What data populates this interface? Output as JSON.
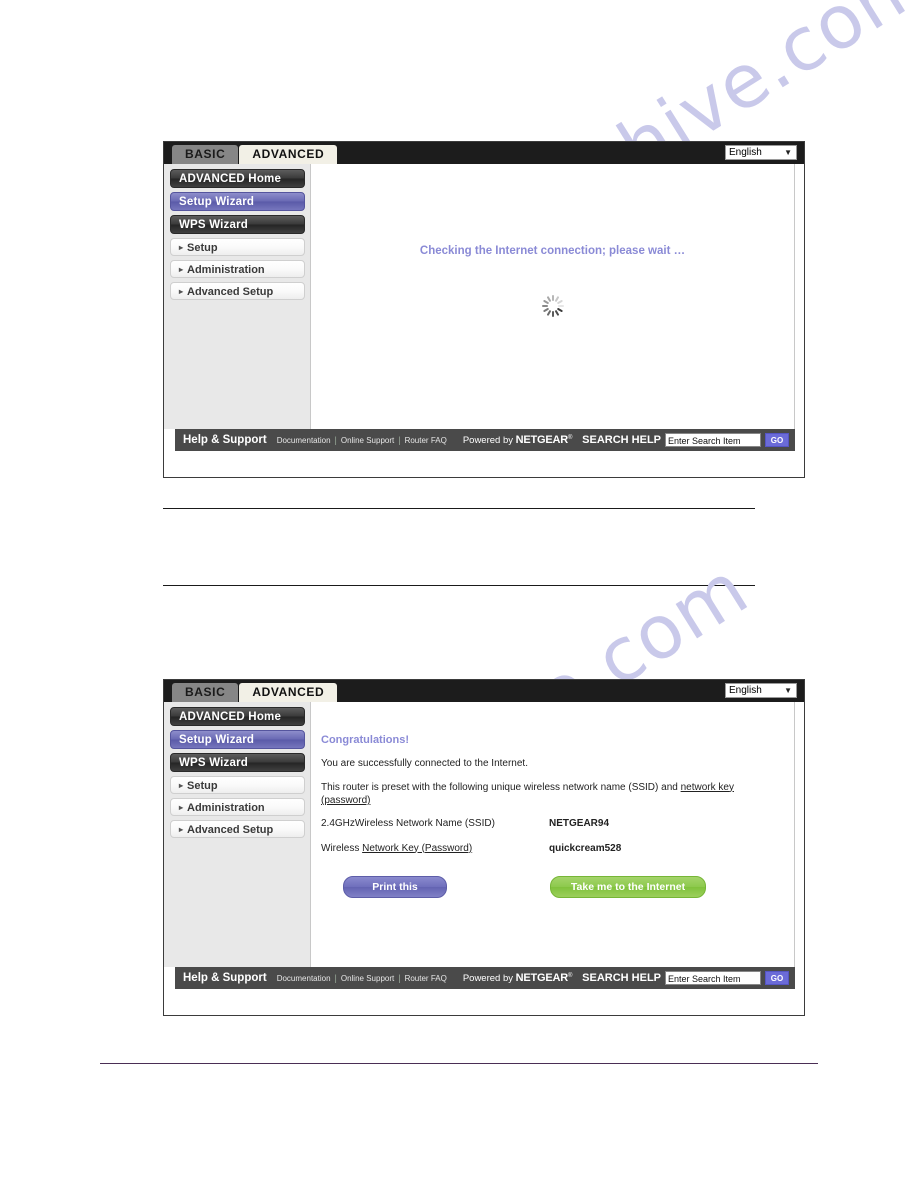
{
  "watermark": {
    "text_1": "manualshive.com",
    "text_2": "manualshive.com",
    "color": "#c9c9ea"
  },
  "colors": {
    "accent_purple": "#6a6ab4",
    "accent_green": "#8dc94c",
    "message_purple": "#8a8ad6",
    "go_button": "#6b6bd8",
    "footer_bar": "#4a4a4a",
    "tabbar": "#1c1c1c",
    "sidebar_bg": "#e8e8e8",
    "doc_rule": "#1a1a1a",
    "bottom_rule": "#4a2e55"
  },
  "header": {
    "tab_basic": "BASIC",
    "tab_advanced": "ADVANCED",
    "language": "English",
    "caret_icon": "chevron-down-icon"
  },
  "sidebar": {
    "items": [
      {
        "label": "ADVANCED Home",
        "style": "dark"
      },
      {
        "label": "Setup Wizard",
        "style": "purple"
      },
      {
        "label": "WPS Wizard",
        "style": "dark"
      }
    ],
    "links": [
      {
        "label": "Setup",
        "arrow": "▸"
      },
      {
        "label": "Administration",
        "arrow": "▸"
      },
      {
        "label": "Advanced Setup",
        "arrow": "▸"
      }
    ]
  },
  "panel_1": {
    "name": "checking-internet-connection",
    "message": "Checking the Internet connection; please wait …",
    "spinner_icon": "loading-spinner-icon"
  },
  "panel_2": {
    "name": "setup-wizard-congratulations",
    "title": "Congratulations!",
    "line_1": "You are successfully connected to the Internet.",
    "line_2_pre": "This router is preset with the following unique wireless network name (SSID) and ",
    "line_2_link": "network key (password)",
    "rows": [
      {
        "label": "2.4GHzWireless Network Name (SSID)",
        "value": "NETGEAR94",
        "link": ""
      },
      {
        "label_pre": "Wireless ",
        "label_link": "Network Key (Password)",
        "label": "Wireless Network Key (Password)",
        "value": "quickcream528"
      }
    ],
    "buttons": {
      "print": "Print this",
      "internet": "Take me to the Internet"
    }
  },
  "footer": {
    "title": "Help & Support",
    "links": [
      "Documentation",
      "Online Support",
      "Router FAQ"
    ],
    "separator": "|",
    "powered_pre": "Powered by ",
    "powered_brand": "NETGEAR",
    "powered_sup": "®",
    "search_help_label": "SEARCH HELP",
    "search_placeholder": "Enter Search Item",
    "search_value": "Enter Search Item",
    "go_label": "GO"
  }
}
